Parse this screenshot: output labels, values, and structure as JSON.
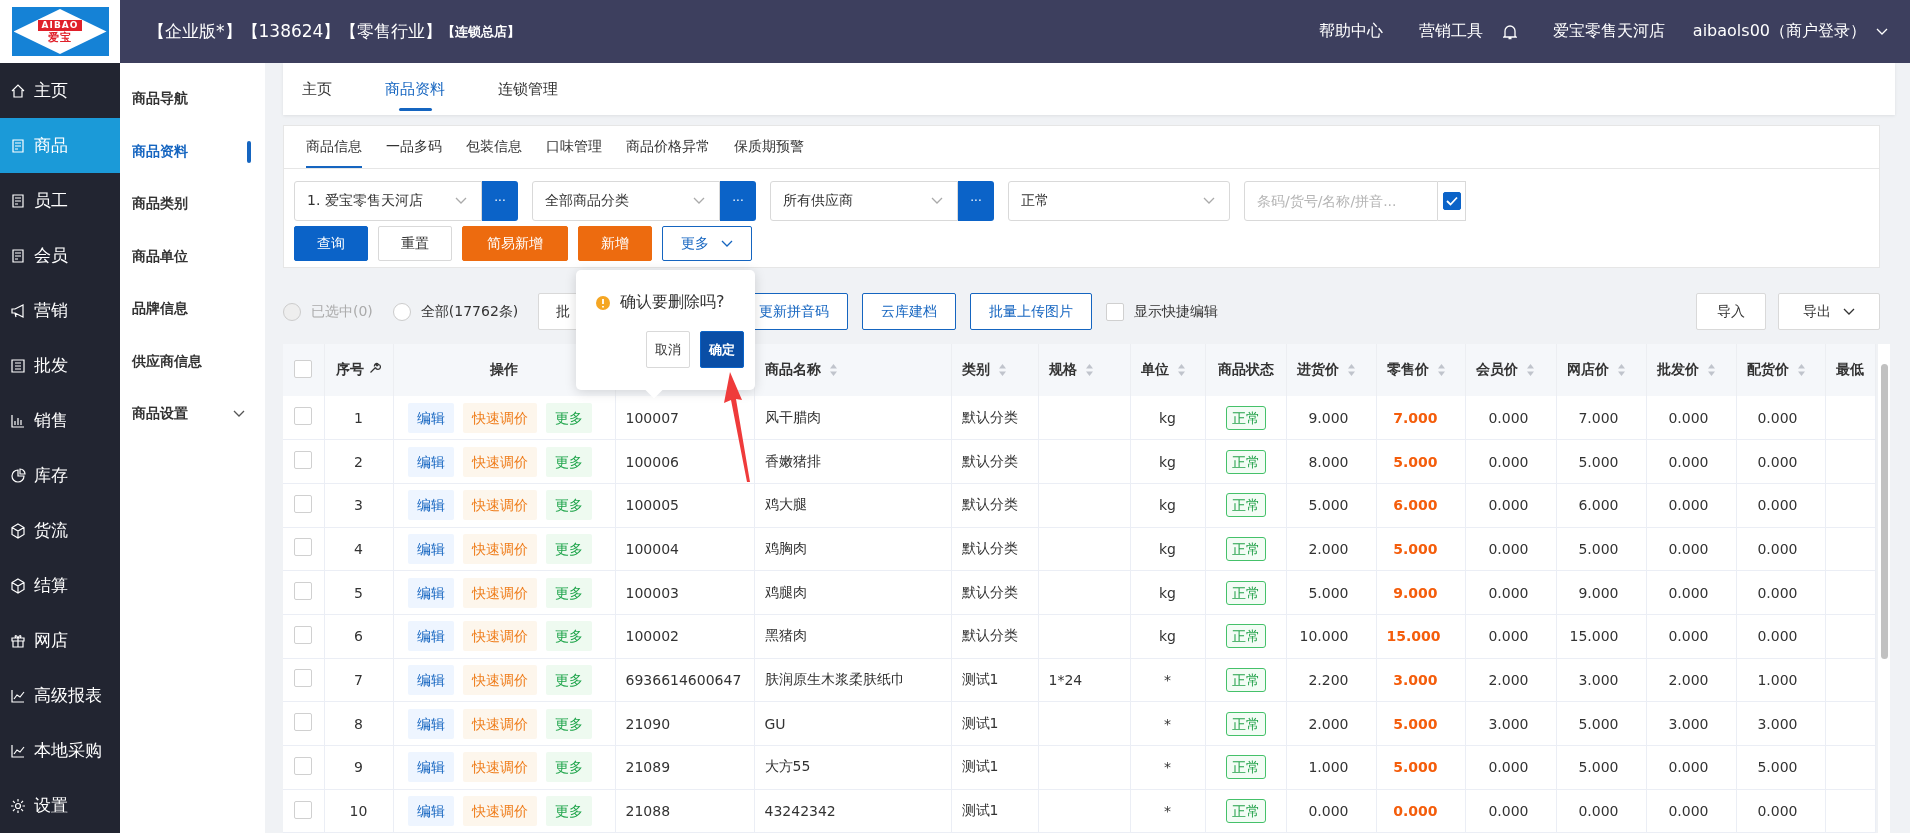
{
  "logo": {
    "top": "AIBAO",
    "bottom": "爱宝"
  },
  "topbar": {
    "title": "【企业版*】【138624】【零售行业】",
    "title_tag": "【连锁总店】",
    "links": [
      "帮助中心",
      "营销工具"
    ],
    "store": "爱宝零售天河店",
    "user": "aibaols00（商户登录）"
  },
  "sidebar": {
    "items": [
      {
        "label": "主页",
        "kind": "home",
        "selected": false
      },
      {
        "label": "商品",
        "kind": "doc",
        "selected": true
      },
      {
        "label": "员工",
        "kind": "doc",
        "selected": false
      },
      {
        "label": "会员",
        "kind": "doc",
        "selected": false
      },
      {
        "label": "营销",
        "kind": "megaphone",
        "selected": false
      },
      {
        "label": "批发",
        "kind": "list",
        "selected": false
      },
      {
        "label": "销售",
        "kind": "bars",
        "selected": false
      },
      {
        "label": "库存",
        "kind": "pie",
        "selected": false
      },
      {
        "label": "货流",
        "kind": "cube",
        "selected": false
      },
      {
        "label": "结算",
        "kind": "cube",
        "selected": false
      },
      {
        "label": "网店",
        "kind": "gift",
        "selected": false
      },
      {
        "label": "高级报表",
        "kind": "line",
        "selected": false
      },
      {
        "label": "本地采购",
        "kind": "line",
        "selected": false
      },
      {
        "label": "设置",
        "kind": "gear",
        "selected": false
      }
    ]
  },
  "subnav": {
    "items": [
      {
        "label": "商品导航",
        "selected": false
      },
      {
        "label": "商品资料",
        "selected": true
      },
      {
        "label": "商品类别",
        "selected": false
      },
      {
        "label": "商品单位",
        "selected": false
      },
      {
        "label": "品牌信息",
        "selected": false
      },
      {
        "label": "供应商信息",
        "selected": false
      },
      {
        "label": "商品设置",
        "selected": false,
        "expandable": true
      }
    ]
  },
  "tabs": [
    {
      "label": "主页",
      "selected": false
    },
    {
      "label": "商品资料",
      "selected": true
    },
    {
      "label": "连锁管理",
      "selected": false
    }
  ],
  "subtabs": [
    {
      "label": "商品信息",
      "selected": true
    },
    {
      "label": "一品多码",
      "selected": false
    },
    {
      "label": "包装信息",
      "selected": false
    },
    {
      "label": "口味管理",
      "selected": false
    },
    {
      "label": "商品价格异常",
      "selected": false
    },
    {
      "label": "保质期预警",
      "selected": false
    }
  ],
  "filters": {
    "selects": [
      {
        "value": "1. 爱宝零售天河店",
        "picker": "···"
      },
      {
        "value": "全部商品分类",
        "picker": "···"
      },
      {
        "value": "所有供应商",
        "picker": "···"
      },
      {
        "value": "正常"
      }
    ],
    "search": {
      "placeholder": "条码/货号/名称/拼音..."
    },
    "search_checkbox": {
      "checked": true
    },
    "buttons": [
      {
        "label": "查询",
        "kind": "primary"
      },
      {
        "label": "重置",
        "kind": "default"
      },
      {
        "label": "简易新增",
        "kind": "warning"
      },
      {
        "label": "新增",
        "kind": "warning"
      },
      {
        "label": "更多",
        "kind": "outline",
        "dropdown": true
      }
    ]
  },
  "toolbar": {
    "radios": [
      {
        "label": "已选中(0)",
        "selected": false,
        "disabled": true
      },
      {
        "label": "全部(17762条)",
        "selected": false,
        "disabled": false
      }
    ],
    "buttons": [
      {
        "label": "批",
        "kind": "default"
      },
      {
        "label": "更新拼音码",
        "kind": "outline"
      },
      {
        "label": "云库建档",
        "kind": "outline"
      },
      {
        "label": "批量上传图片",
        "kind": "outline"
      }
    ],
    "checkbox": {
      "label": "显示快捷编辑",
      "checked": false
    },
    "right_buttons": [
      {
        "label": "导入",
        "dropdown": false
      },
      {
        "label": "导出",
        "dropdown": true
      }
    ]
  },
  "table": {
    "header_checkbox": {
      "checked": false
    },
    "columns": [
      {
        "label": "序号",
        "sortable": false,
        "tool": true
      },
      {
        "label": "操作",
        "sortable": false
      },
      {},
      {
        "label": "商品名称",
        "sortable": true
      },
      {
        "label": "类别",
        "sortable": true
      },
      {
        "label": "规格",
        "sortable": true
      },
      {
        "label": "单位",
        "sortable": true
      },
      {
        "label": "商品状态",
        "sortable": false
      },
      {
        "label": "进货价",
        "sortable": true
      },
      {
        "label": "零售价",
        "sortable": true
      },
      {
        "label": "会员价",
        "sortable": true
      },
      {
        "label": "网店价",
        "sortable": true
      },
      {
        "label": "批发价",
        "sortable": true
      },
      {
        "label": "配货价",
        "sortable": true
      },
      {
        "label": "最低",
        "sortable": false
      }
    ],
    "rows": [
      {
        "selected": false,
        "no": "1",
        "actions": [
          "编辑",
          "快速调价",
          "更多"
        ],
        "code": "100007",
        "name": "风干腊肉",
        "category": "默认分类",
        "spec": "",
        "unit": "kg",
        "status": "正常",
        "cost": "9.000",
        "retail": "7.000",
        "member": "0.000",
        "online": "7.000",
        "wholesale": "0.000",
        "distribution": "0.000"
      },
      {
        "selected": false,
        "no": "2",
        "actions": [
          "编辑",
          "快速调价",
          "更多"
        ],
        "code": "100006",
        "name": "香嫩猪排",
        "category": "默认分类",
        "spec": "",
        "unit": "kg",
        "status": "正常",
        "cost": "8.000",
        "retail": "5.000",
        "member": "0.000",
        "online": "5.000",
        "wholesale": "0.000",
        "distribution": "0.000"
      },
      {
        "selected": false,
        "no": "3",
        "actions": [
          "编辑",
          "快速调价",
          "更多"
        ],
        "code": "100005",
        "name": "鸡大腿",
        "category": "默认分类",
        "spec": "",
        "unit": "kg",
        "status": "正常",
        "cost": "5.000",
        "retail": "6.000",
        "member": "0.000",
        "online": "6.000",
        "wholesale": "0.000",
        "distribution": "0.000"
      },
      {
        "selected": false,
        "no": "4",
        "actions": [
          "编辑",
          "快速调价",
          "更多"
        ],
        "code": "100004",
        "name": "鸡胸肉",
        "category": "默认分类",
        "spec": "",
        "unit": "kg",
        "status": "正常",
        "cost": "2.000",
        "retail": "5.000",
        "member": "0.000",
        "online": "5.000",
        "wholesale": "0.000",
        "distribution": "0.000"
      },
      {
        "selected": false,
        "no": "5",
        "actions": [
          "编辑",
          "快速调价",
          "更多"
        ],
        "code": "100003",
        "name": "鸡腿肉",
        "category": "默认分类",
        "spec": "",
        "unit": "kg",
        "status": "正常",
        "cost": "5.000",
        "retail": "9.000",
        "member": "0.000",
        "online": "9.000",
        "wholesale": "0.000",
        "distribution": "0.000"
      },
      {
        "selected": false,
        "no": "6",
        "actions": [
          "编辑",
          "快速调价",
          "更多"
        ],
        "code": "100002",
        "name": "黑猪肉",
        "category": "默认分类",
        "spec": "",
        "unit": "kg",
        "status": "正常",
        "cost": "10.000",
        "retail": "15.000",
        "member": "0.000",
        "online": "15.000",
        "wholesale": "0.000",
        "distribution": "0.000"
      },
      {
        "selected": false,
        "no": "7",
        "actions": [
          "编辑",
          "快速调价",
          "更多"
        ],
        "code": "6936614600647",
        "name": "肤润原生木浆柔肤纸巾",
        "category": "测试1",
        "spec": "1*24",
        "unit": "*",
        "status": "正常",
        "cost": "2.200",
        "retail": "3.000",
        "member": "2.000",
        "online": "3.000",
        "wholesale": "2.000",
        "distribution": "1.000"
      },
      {
        "selected": false,
        "no": "8",
        "actions": [
          "编辑",
          "快速调价",
          "更多"
        ],
        "code": "21090",
        "name": "GU",
        "category": "测试1",
        "spec": "",
        "unit": "*",
        "status": "正常",
        "cost": "2.000",
        "retail": "5.000",
        "member": "3.000",
        "online": "5.000",
        "wholesale": "3.000",
        "distribution": "3.000"
      },
      {
        "selected": false,
        "no": "9",
        "actions": [
          "编辑",
          "快速调价",
          "更多"
        ],
        "code": "21089",
        "name": "大方55",
        "category": "测试1",
        "spec": "",
        "unit": "*",
        "status": "正常",
        "cost": "1.000",
        "retail": "5.000",
        "member": "0.000",
        "online": "5.000",
        "wholesale": "0.000",
        "distribution": "5.000"
      },
      {
        "selected": false,
        "no": "10",
        "actions": [
          "编辑",
          "快速调价",
          "更多"
        ],
        "code": "21088",
        "name": "43242342",
        "category": "测试1",
        "spec": "",
        "unit": "*",
        "status": "正常",
        "cost": "0.000",
        "retail": "0.000",
        "member": "0.000",
        "online": "0.000",
        "wholesale": "0.000",
        "distribution": "0.000"
      }
    ]
  },
  "popconfirm": {
    "message": "确认要删除吗?",
    "buttons": [
      {
        "label": "取消",
        "kind": "default"
      },
      {
        "label": "确定",
        "kind": "primary"
      }
    ]
  }
}
